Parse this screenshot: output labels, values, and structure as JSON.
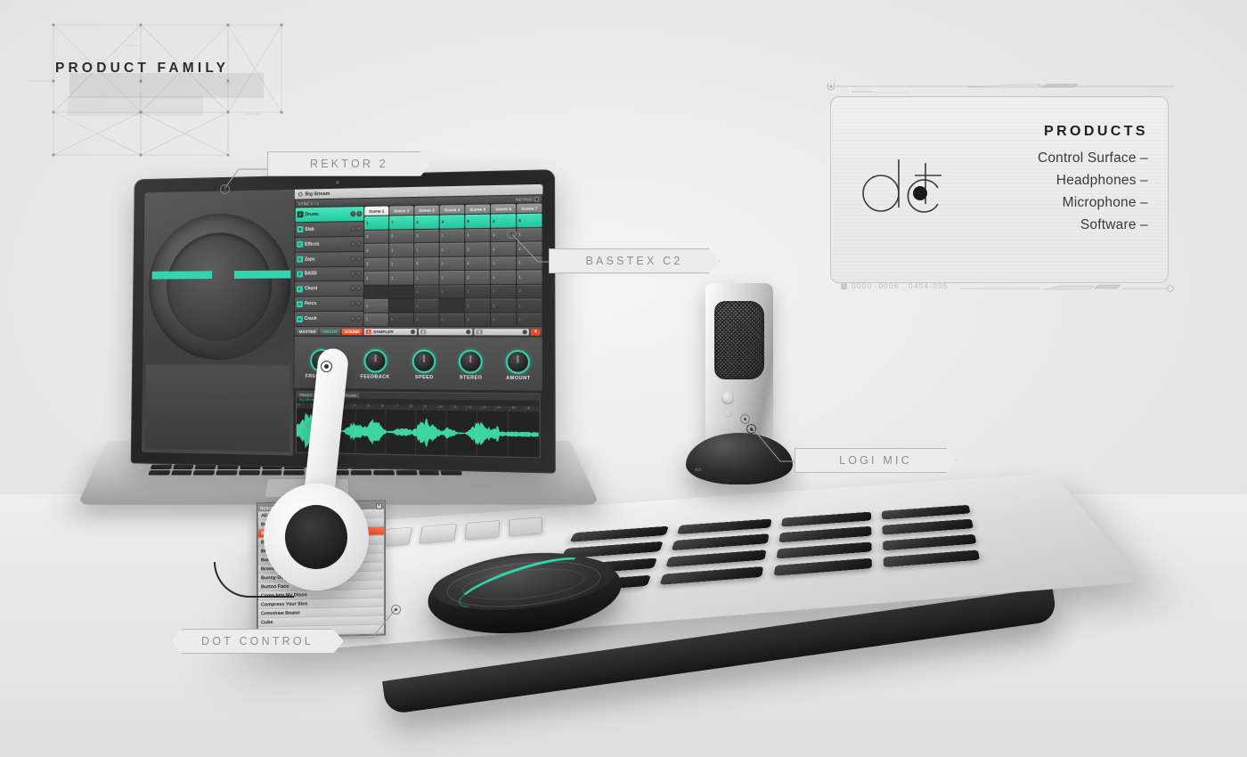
{
  "page": {
    "title": "PRODUCT FAMILY",
    "accent_color": "#2fd6b0",
    "highlight_color": "#ef4a22",
    "background_color": "#ececec"
  },
  "callouts": [
    {
      "id": "rektor",
      "label": "REKTOR 2"
    },
    {
      "id": "basstex",
      "label": "BASSTEX C2"
    },
    {
      "id": "logimic",
      "label": "LOGI MIC"
    },
    {
      "id": "dotctrl",
      "label": "DOT CONTROL"
    }
  ],
  "products_panel": {
    "logo_text": "dct",
    "heading": "PRODUCTS",
    "items": [
      "Control Surface –",
      "Headphones –",
      "Microphone –",
      "Software –"
    ],
    "serial": "0000 .0006 . 0454-005"
  },
  "daw": {
    "window_title": "Big Stream",
    "sync_label": "SYNC 1 / 1",
    "retrig_label": "RETRIG",
    "scene_tabs": [
      {
        "label": "Scene 1",
        "selected": true
      },
      {
        "label": "Scene 2",
        "selected": false
      },
      {
        "label": "Scene 3",
        "selected": false
      },
      {
        "label": "Scene 4",
        "selected": false
      },
      {
        "label": "Scene 5",
        "selected": false
      },
      {
        "label": "Scene 6",
        "selected": false
      },
      {
        "label": "Scene 7",
        "selected": false
      }
    ],
    "tracks": [
      {
        "letter": "A",
        "name": "Drums",
        "active": true
      },
      {
        "letter": "B",
        "name": "Stab",
        "active": false
      },
      {
        "letter": "C",
        "name": "Effects",
        "active": false
      },
      {
        "letter": "D",
        "name": "Zaps",
        "active": false
      },
      {
        "letter": "E",
        "name": "BASS",
        "active": false
      },
      {
        "letter": "F",
        "name": "Chord",
        "active": false
      },
      {
        "letter": "G",
        "name": "Percs",
        "active": false
      },
      {
        "letter": "H",
        "name": "Crash",
        "active": false
      }
    ],
    "clip_grid": [
      {
        "values": [
          "1",
          "7",
          "3",
          "4",
          "5",
          "2",
          "6"
        ],
        "state": [
          "on",
          "on",
          "on",
          "on",
          "on",
          "on",
          "on"
        ]
      },
      {
        "values": [
          "2",
          "2",
          "2",
          "1",
          "1",
          "1",
          "1"
        ],
        "state": [
          "idle",
          "idle",
          "idle",
          "idle",
          "idle",
          "idle",
          "idle"
        ]
      },
      {
        "values": [
          "3",
          "1",
          "1",
          "1",
          "3",
          "1",
          "1"
        ],
        "state": [
          "idle",
          "idle",
          "idle",
          "idle",
          "idle",
          "idle",
          "idle"
        ]
      },
      {
        "values": [
          "3",
          "1",
          "5",
          "1",
          "1",
          "1",
          "1"
        ],
        "state": [
          "idle",
          "idle",
          "idle",
          "idle",
          "idle",
          "idle",
          "idle"
        ]
      },
      {
        "values": [
          "2",
          "1",
          "1",
          "1",
          "2",
          "1",
          "1"
        ],
        "state": [
          "idle",
          "idle",
          "idle",
          "idle",
          "idle",
          "idle",
          "idle"
        ]
      },
      {
        "values": [
          "",
          "",
          "1",
          "1",
          "1",
          "1",
          "2"
        ],
        "state": [
          "empty",
          "empty",
          "dim",
          "dim",
          "dim",
          "dim",
          "dim"
        ]
      },
      {
        "values": [
          "1",
          "",
          "1",
          "",
          "1",
          "1",
          "1"
        ],
        "state": [
          "idle",
          "empty",
          "dim",
          "empty",
          "dim",
          "dim",
          "dim"
        ]
      },
      {
        "values": [
          "1",
          "1",
          "1",
          "1",
          "1",
          "1",
          "1"
        ],
        "state": [
          "idle",
          "dim",
          "dim",
          "dim",
          "dim",
          "dim",
          "dim"
        ]
      }
    ],
    "sound_bar": {
      "master_label": "MASTER",
      "group_label": "GROUP",
      "sound_label": "SOUND",
      "slots": [
        {
          "num": "1",
          "name": "SAMPLER"
        },
        {
          "num": "2",
          "name": ""
        },
        {
          "num": "3",
          "name": ""
        }
      ],
      "last_slot": "4"
    },
    "knobs": [
      {
        "label": "FREQUENCY"
      },
      {
        "label": "FEEDBACK"
      },
      {
        "label": "SPEED"
      },
      {
        "label": "STEREO"
      },
      {
        "label": "AMOUNT"
      }
    ],
    "wave_panel": {
      "tabs": [
        {
          "label": "Record",
          "selected": false
        },
        {
          "label": "Edit",
          "selected": false
        },
        {
          "label": "Zone",
          "selected": true
        },
        {
          "label": "Chunks",
          "selected": false
        }
      ],
      "info": "Big Stream - Kit 01",
      "ruler": [
        "0",
        "1",
        "2",
        "3",
        "4",
        "5",
        "6",
        "7",
        "8",
        "9",
        "10",
        "11",
        "12",
        "13",
        "14",
        "15",
        "16"
      ],
      "waveform_color": "#3dd6a0"
    }
  },
  "browser": {
    "header_label": "RESULTS",
    "close_label": "×",
    "items": [
      {
        "label": "All For the L",
        "selected": false
      },
      {
        "label": "Be Mine",
        "selected": false
      },
      {
        "label": "Big Stream",
        "selected": true
      },
      {
        "label": "Bikram",
        "selected": false
      },
      {
        "label": "Blow",
        "selected": false
      },
      {
        "label": "Born Again",
        "selected": false
      },
      {
        "label": "Breeze",
        "selected": false
      },
      {
        "label": "Bunny Over The Ocean",
        "selected": false
      },
      {
        "label": "Button Face",
        "selected": false
      },
      {
        "label": "Come Into My Disco",
        "selected": false
      },
      {
        "label": "Compress Your Sins",
        "selected": false
      },
      {
        "label": "Crenshaw Beater",
        "selected": false
      },
      {
        "label": "Cube",
        "selected": false
      },
      {
        "label": "Dawn",
        "selected": false
      }
    ]
  },
  "microphone": {
    "base_label": "dct"
  }
}
